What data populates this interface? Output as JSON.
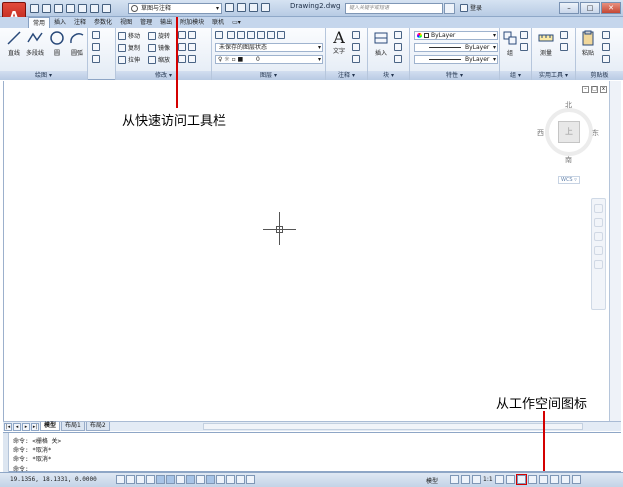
{
  "title_bar": {
    "app_button_label": "A",
    "workspace": "草图与注释",
    "document_title": "Drawing2.dwg",
    "search_placeholder": "键入关键字或短语",
    "login_label": "登录"
  },
  "tabs": [
    {
      "label": "常用",
      "active": true
    },
    {
      "label": "插入"
    },
    {
      "label": "注释"
    },
    {
      "label": "参数化"
    },
    {
      "label": "视图"
    },
    {
      "label": "管理"
    },
    {
      "label": "输出"
    },
    {
      "label": "附加模块"
    },
    {
      "label": "联机"
    }
  ],
  "ribbon": {
    "draw_panel": {
      "title": "绘图",
      "tools": [
        "直线",
        "多段线",
        "圆",
        "圆弧"
      ]
    },
    "modify_panel": {
      "title": "修改",
      "tools": [
        "移动",
        "旋转",
        "复制",
        "镜像",
        "拉伸",
        "缩放"
      ]
    },
    "layers_panel": {
      "title": "图层",
      "layer_state": "未保存的图层状态",
      "current_layer": "0"
    },
    "annotation_panel": {
      "title": "注释",
      "tools": [
        "文字"
      ]
    },
    "block_panel": {
      "title": "块",
      "tools": [
        "插入"
      ]
    },
    "properties_panel": {
      "title": "特性",
      "color": "ByLayer",
      "linetype": "ByLayer",
      "lineweight": "ByLayer"
    },
    "groups_panel": {
      "title": "组",
      "tools": [
        "组"
      ]
    },
    "utilities_panel": {
      "title": "实用工具",
      "tools": [
        "测量"
      ]
    },
    "clipboard_panel": {
      "title": "剪贴板",
      "tools": [
        "粘贴"
      ]
    }
  },
  "viewcube": {
    "north": "北",
    "south": "南",
    "east": "东",
    "west": "西",
    "face": "上",
    "wcs": "WCS"
  },
  "annotations": {
    "qat_label": "从快速访问工具栏",
    "workspace_icon_label": "从工作空间图标"
  },
  "layout_tabs": [
    "模型",
    "布局1",
    "布局2"
  ],
  "command_line": [
    "命令: <栅格 关>",
    "命令: *取消*",
    "命令: *取消*",
    "命令:"
  ],
  "status_bar": {
    "coordinates": "19.1356, 18.1331, 0.0000",
    "model_label": "模型",
    "scale": "1:1"
  }
}
